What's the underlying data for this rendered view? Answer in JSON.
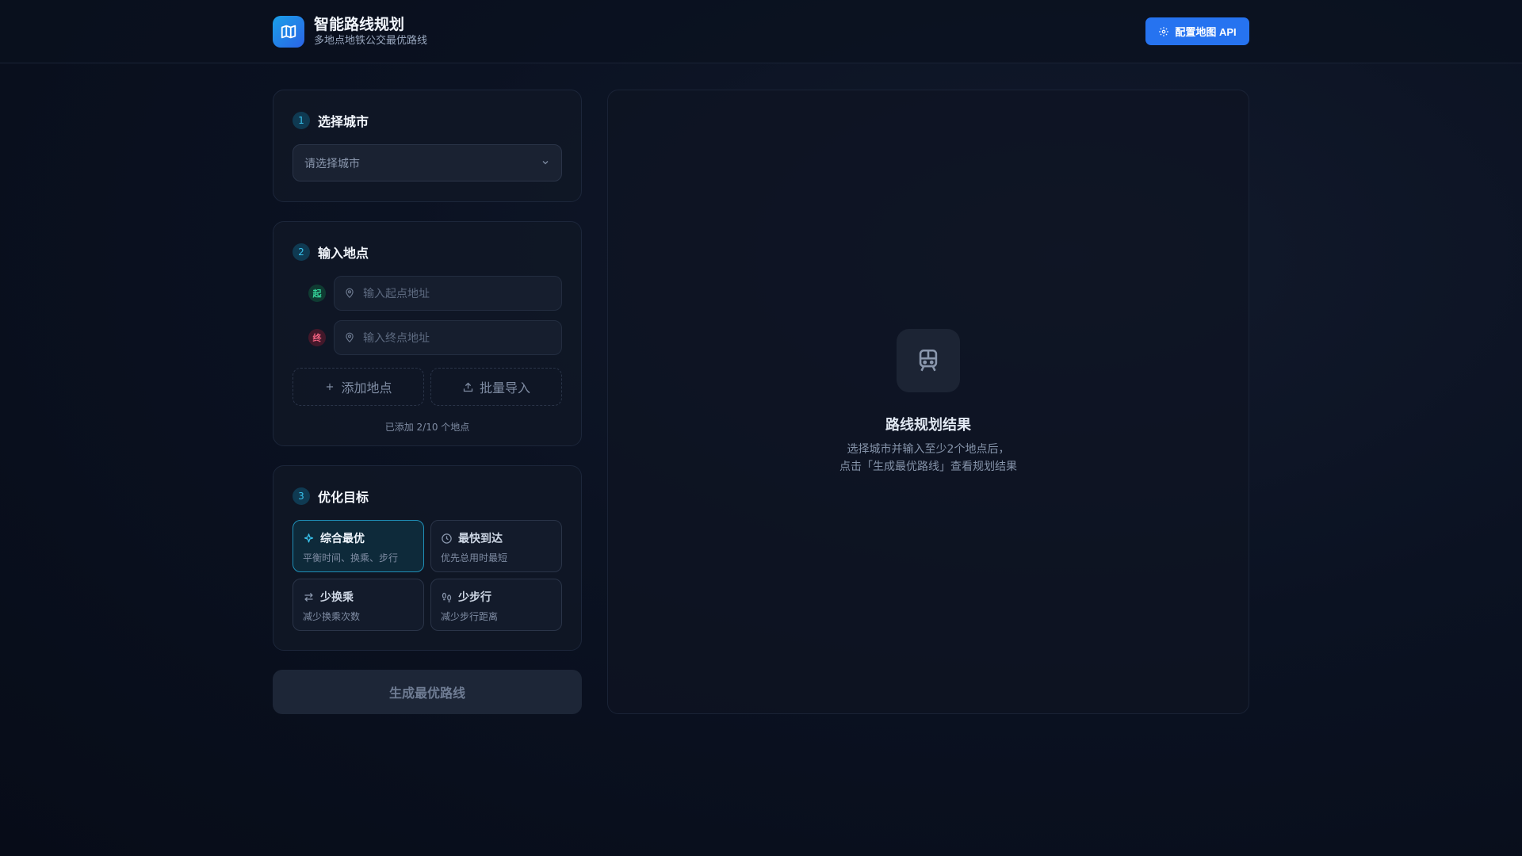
{
  "header": {
    "title": "智能路线规划",
    "subtitle": "多地点地铁公交最优路线",
    "api_button": "配置地图 API"
  },
  "city": {
    "step": "1",
    "title": "选择城市",
    "placeholder": "请选择城市"
  },
  "locations": {
    "step": "2",
    "title": "输入地点",
    "start_badge": "起",
    "start_placeholder": "输入起点地址",
    "end_badge": "终",
    "end_placeholder": "输入终点地址",
    "add_button": "添加地点",
    "import_button": "批量导入",
    "count_text": "已添加 2/10 个地点"
  },
  "goals": {
    "step": "3",
    "title": "优化目标",
    "items": [
      {
        "name": "综合最优",
        "desc": "平衡时间、换乘、步行"
      },
      {
        "name": "最快到达",
        "desc": "优先总用时最短"
      },
      {
        "name": "少换乘",
        "desc": "减少换乘次数"
      },
      {
        "name": "少步行",
        "desc": "减少步行距离"
      }
    ]
  },
  "generate_button": "生成最优路线",
  "result": {
    "title": "路线规划结果",
    "desc_line1": "选择城市并输入至少2个地点后，",
    "desc_line2": "点击「生成最优路线」查看规划结果"
  },
  "colors": {
    "accent": "#2673f0",
    "active_goal": "#1f8fb7",
    "start": "#34d399",
    "end": "#f0607f"
  }
}
